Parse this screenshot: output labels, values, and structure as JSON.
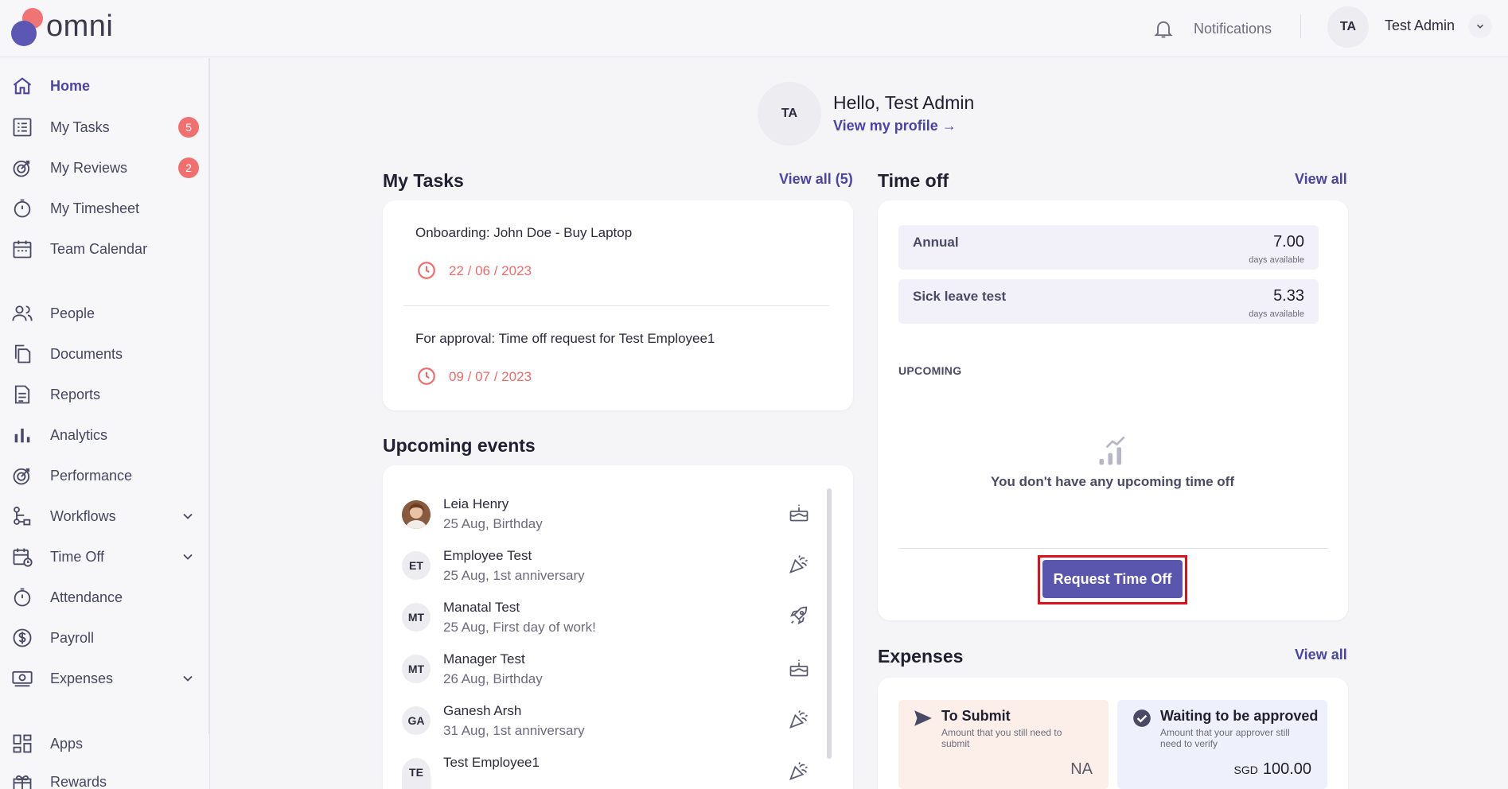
{
  "app": {
    "logo_text": "omni"
  },
  "topbar": {
    "notifications_label": "Notifications",
    "user_initials": "TA",
    "user_name": "Test Admin"
  },
  "sidebar": {
    "items": [
      {
        "label": "Home"
      },
      {
        "label": "My Tasks",
        "badge": "5"
      },
      {
        "label": "My Reviews",
        "badge": "2"
      },
      {
        "label": "My Timesheet"
      },
      {
        "label": "Team Calendar"
      },
      {
        "label": "People"
      },
      {
        "label": "Documents"
      },
      {
        "label": "Reports"
      },
      {
        "label": "Analytics"
      },
      {
        "label": "Performance"
      },
      {
        "label": "Workflows"
      },
      {
        "label": "Time Off"
      },
      {
        "label": "Attendance"
      },
      {
        "label": "Payroll"
      },
      {
        "label": "Expenses"
      },
      {
        "label": "Apps"
      },
      {
        "label": "Rewards"
      }
    ]
  },
  "greeting": {
    "initials": "TA",
    "title": "Hello, Test Admin",
    "profile_link": "View my profile →"
  },
  "tasks": {
    "title": "My Tasks",
    "view_all": "View all (5)",
    "items": [
      {
        "title": "Onboarding: John Doe - Buy Laptop",
        "date": "22 / 06 / 2023"
      },
      {
        "title": "For approval: Time off request for Test Employee1",
        "date": "09 / 07 / 2023"
      }
    ]
  },
  "events": {
    "title": "Upcoming events",
    "items": [
      {
        "initials": "",
        "name": "Leia Henry",
        "detail": "25 Aug, Birthday",
        "icon": "cake-icon"
      },
      {
        "initials": "ET",
        "name": "Employee Test",
        "detail": "25 Aug, 1st anniversary",
        "icon": "party-popper-icon"
      },
      {
        "initials": "MT",
        "name": "Manatal Test",
        "detail": "25 Aug, First day of work!",
        "icon": "rocket-icon"
      },
      {
        "initials": "MT",
        "name": "Manager Test",
        "detail": "26 Aug, Birthday",
        "icon": "cake-icon"
      },
      {
        "initials": "GA",
        "name": "Ganesh Arsh",
        "detail": "31 Aug, 1st anniversary",
        "icon": "party-popper-icon"
      },
      {
        "initials": "TE",
        "name": "Test Employee1",
        "detail": "",
        "icon": "party-popper-icon"
      }
    ]
  },
  "timeoff": {
    "title": "Time off",
    "view_all": "View all",
    "balances": [
      {
        "name": "Annual",
        "value": "7.00",
        "unit": "days available"
      },
      {
        "name": "Sick leave test",
        "value": "5.33",
        "unit": "days available"
      }
    ],
    "upcoming_label": "UPCOMING",
    "empty_message": "You don't have any upcoming time off",
    "request_button": "Request Time Off"
  },
  "expenses": {
    "title": "Expenses",
    "view_all": "View all",
    "to_submit": {
      "title": "To Submit",
      "desc": "Amount that you still need to submit",
      "amount": "NA"
    },
    "waiting": {
      "title": "Waiting to be approved",
      "desc": "Amount that your approver still need to verify",
      "currency": "SGD",
      "amount": "100.00"
    }
  },
  "colors": {
    "accent": "#4b43a6",
    "alert": "#ef6a6a",
    "highlight": "#e0101b"
  }
}
